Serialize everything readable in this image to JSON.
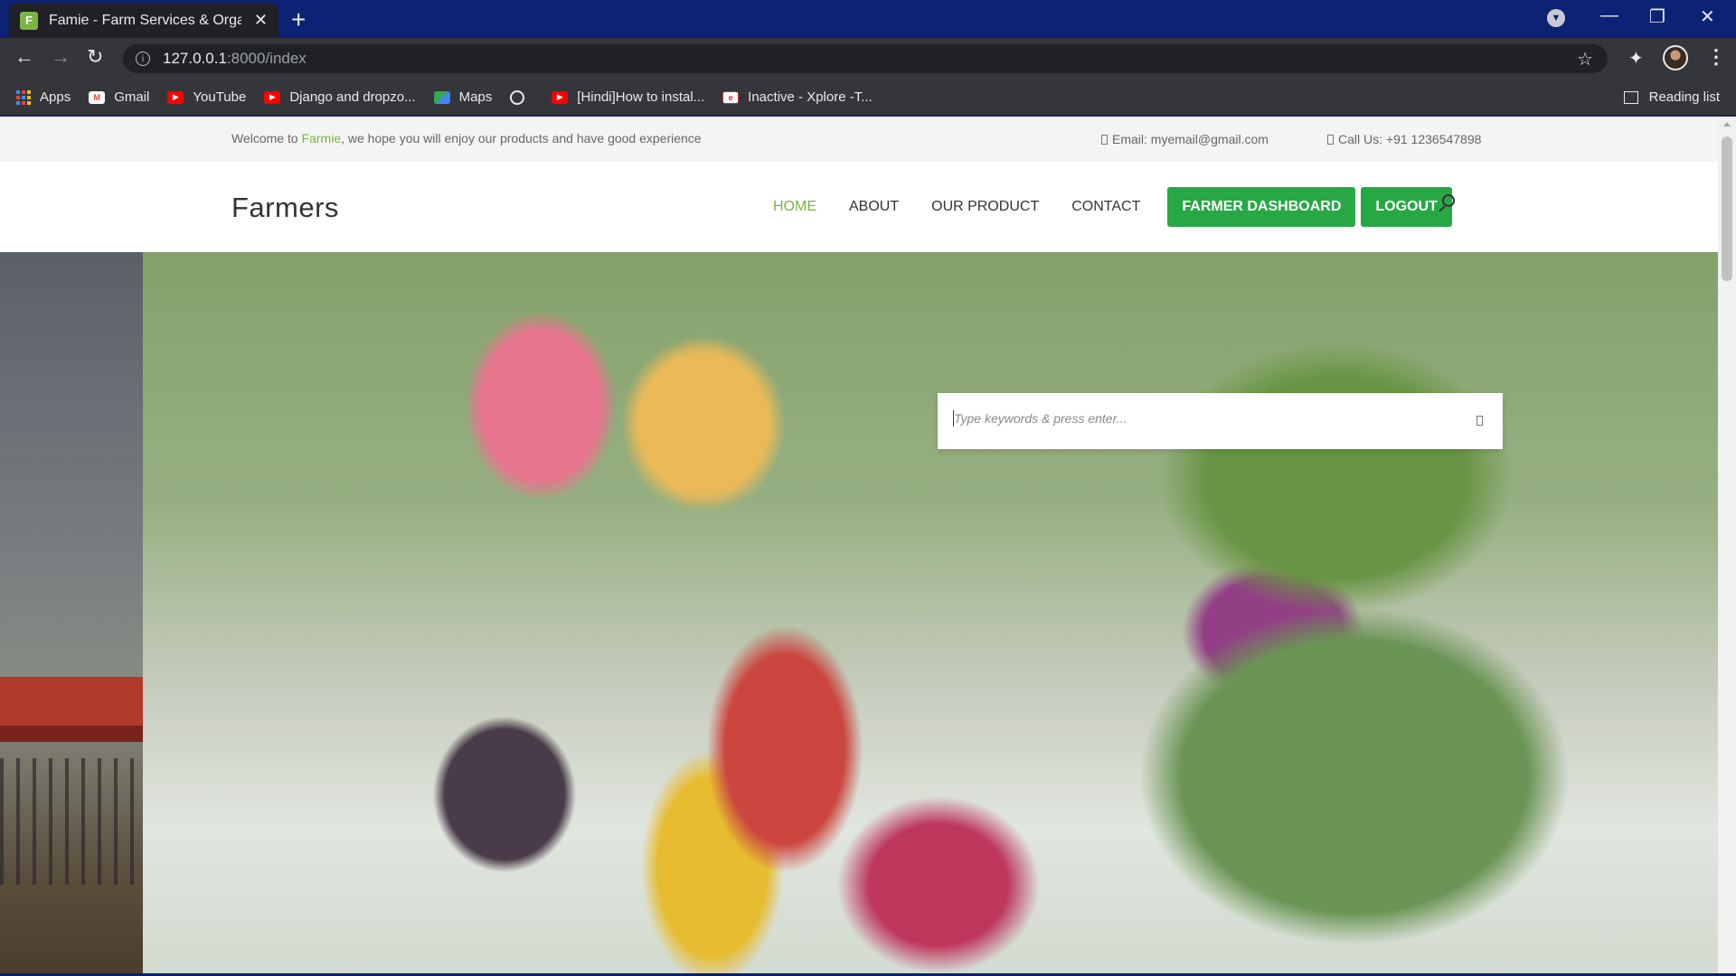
{
  "browser": {
    "tab": {
      "favicon_letter": "F",
      "title": "Famie - Farm Services & Organic"
    },
    "url": {
      "host": "127.0.0.1",
      "path": ":8000/index"
    },
    "bookmarks": [
      {
        "label": "Apps",
        "icon": "apps-grid-icon"
      },
      {
        "label": "Gmail",
        "icon": "gmail-icon"
      },
      {
        "label": "YouTube",
        "icon": "youtube-icon"
      },
      {
        "label": "Django and dropzo...",
        "icon": "youtube-icon"
      },
      {
        "label": "Maps",
        "icon": "maps-icon"
      },
      {
        "label": "",
        "icon": "globe-icon"
      },
      {
        "label": "[Hindi]How to instal...",
        "icon": "youtube-icon"
      },
      {
        "label": "Inactive - Xplore -T...",
        "icon": "xplore-icon"
      }
    ],
    "reading_list": "Reading list"
  },
  "topbar": {
    "welcome_prefix": "Welcome to ",
    "brand": "Farmie",
    "welcome_suffix": ", we hope you will enjoy our products and have good experience",
    "email": "Email: myemail@gmail.com",
    "phone": "Call Us: +91 1236547898"
  },
  "header": {
    "logo": "Farmers",
    "nav": {
      "home": "HOME",
      "about": "ABOUT",
      "product": "OUR PRODUCT",
      "contact": "CONTACT",
      "dashboard": "FARMER DASHBOARD",
      "logout": "LOGOUT"
    }
  },
  "search": {
    "placeholder": "Type keywords & press enter..."
  },
  "colors": {
    "accent_green": "#7cb342",
    "button_green": "#28a745",
    "chrome_blue": "#0d2274"
  }
}
